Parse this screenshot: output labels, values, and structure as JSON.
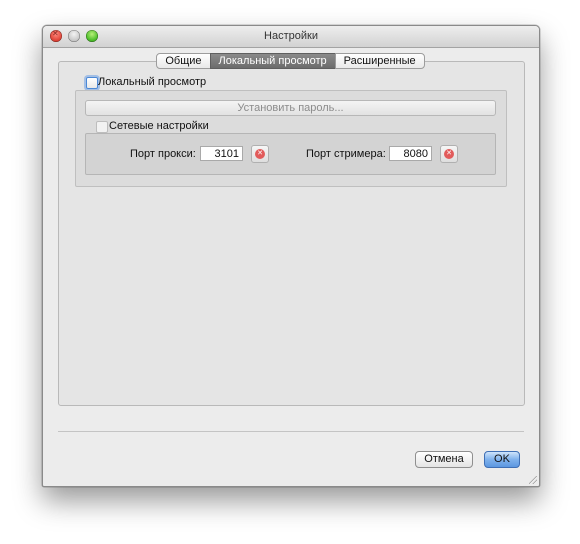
{
  "window": {
    "title": "Настройки"
  },
  "tabs": [
    {
      "label": "Общие",
      "active": false
    },
    {
      "label": "Локальный просмотр",
      "active": true
    },
    {
      "label": "Расширенные",
      "active": false
    }
  ],
  "local_view": {
    "enable_label": "Локальный просмотр",
    "set_password_label": "Установить пароль...",
    "network_settings_label": "Сетевые настройки",
    "proxy_port": {
      "label": "Порт прокси:",
      "value": "3101"
    },
    "streamer_port": {
      "label": "Порт стримера:",
      "value": "8080"
    }
  },
  "footer": {
    "cancel_label": "Отмена",
    "ok_label": "OK"
  },
  "colors": {
    "active_tab": "#707070",
    "default_button": "#6fa6e8",
    "focus_ring": "#4b88d6",
    "clear_icon": "#e25b5b"
  }
}
